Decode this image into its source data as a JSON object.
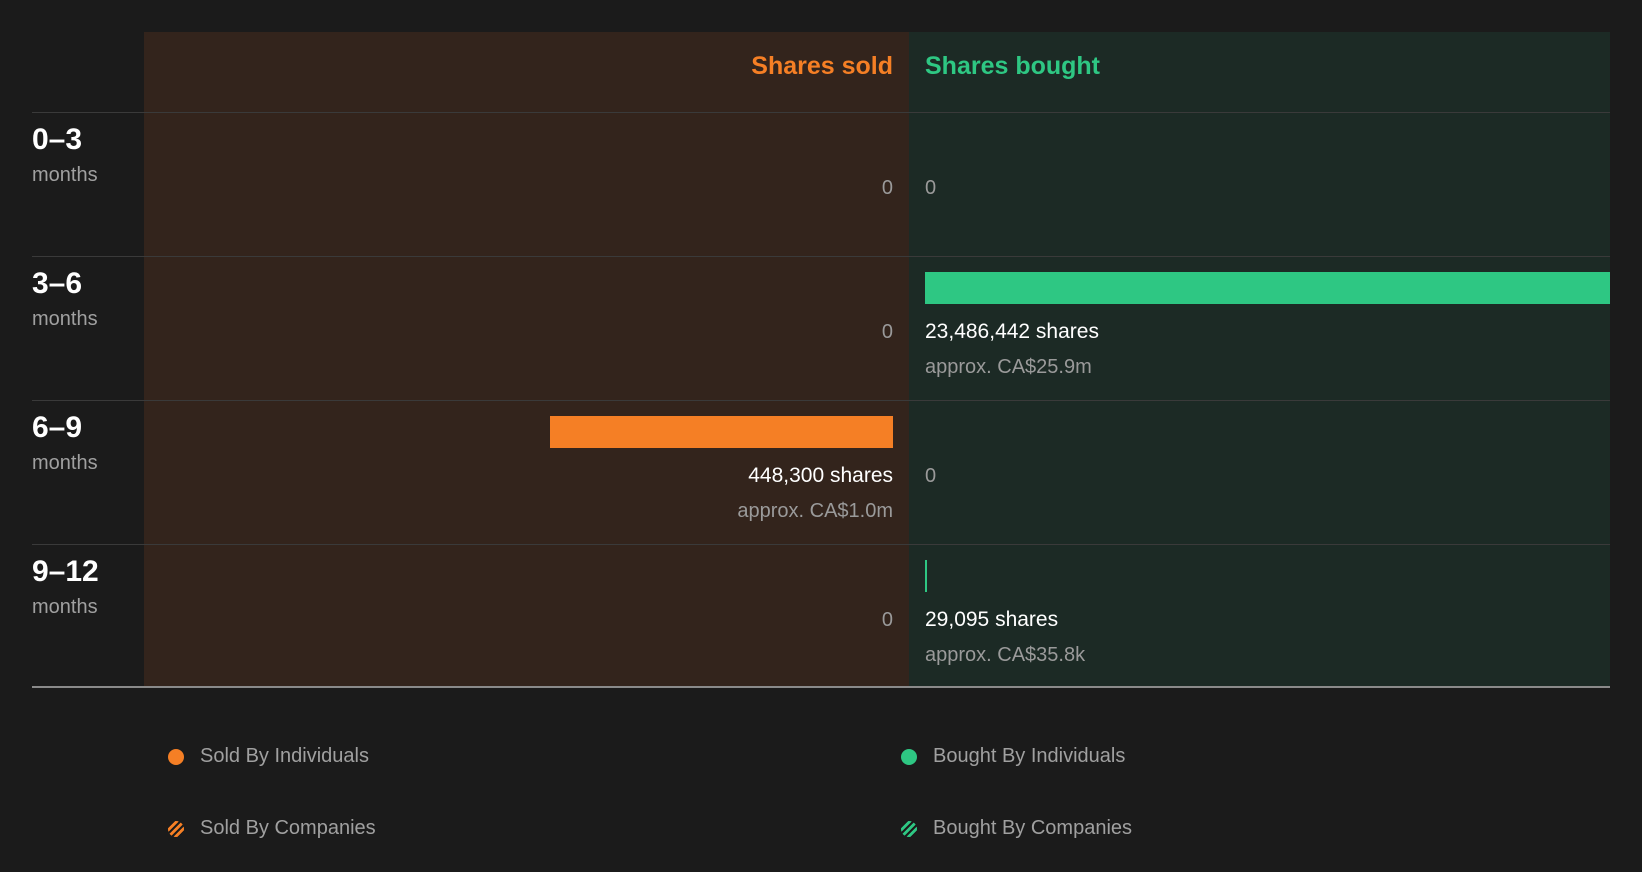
{
  "headers": {
    "sold": "Shares sold",
    "bought": "Shares bought"
  },
  "colors": {
    "sold": "#f57f25",
    "bought": "#2ec783"
  },
  "rows": [
    {
      "period": "0–3",
      "unit": "months",
      "sold": "0",
      "bought": "0"
    },
    {
      "period": "3–6",
      "unit": "months",
      "sold": "0",
      "bought_shares": "23,486,442 shares",
      "bought_approx": "approx. CA$25.9m"
    },
    {
      "period": "6–9",
      "unit": "months",
      "sold_shares": "448,300 shares",
      "sold_approx": "approx. CA$1.0m",
      "bought": "0"
    },
    {
      "period": "9–12",
      "unit": "months",
      "sold": "0",
      "bought_shares": "29,095 shares",
      "bought_approx": "approx. CA$35.8k"
    }
  ],
  "legend": {
    "sold_individuals": "Sold By Individuals",
    "bought_individuals": "Bought By Individuals",
    "sold_companies": "Sold By Companies",
    "bought_companies": "Bought By Companies"
  },
  "chart_data": {
    "type": "bar",
    "categories": [
      "0–3 months",
      "3–6 months",
      "6–9 months",
      "9–12 months"
    ],
    "series": [
      {
        "name": "Shares sold",
        "values": [
          0,
          0,
          448300,
          0
        ]
      },
      {
        "name": "Shares bought",
        "values": [
          0,
          23486442,
          0,
          29095
        ]
      }
    ]
  }
}
